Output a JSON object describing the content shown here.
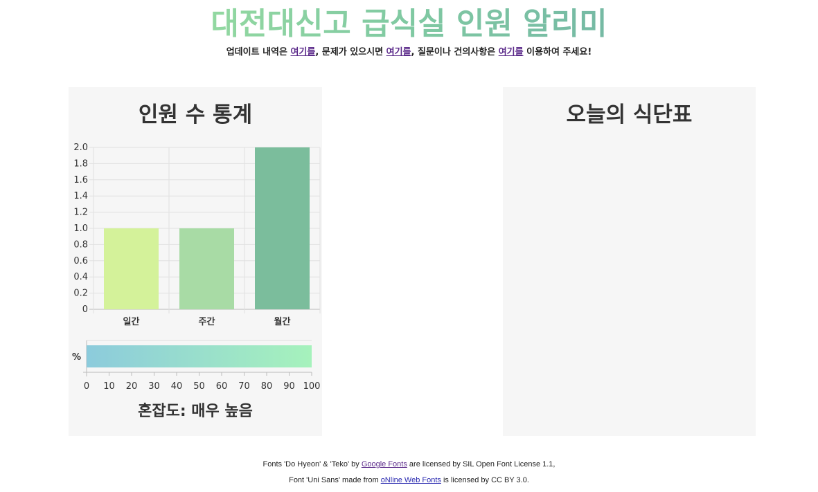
{
  "header": {
    "title": "대전대신고 급식실 인원 알리미",
    "notice": {
      "t1": "업데이트 내역은 ",
      "link1": "여기를",
      "t2": ", 문제가 있으시면 ",
      "link2": "여기를",
      "t3": ", 질문이나 건의사항은 ",
      "link3": "여기를",
      "t4": " 이용하여 주세요!"
    }
  },
  "stats_panel": {
    "title": "인원 수 통계",
    "congestion_label": "혼잡도: 매우 높음"
  },
  "menu_panel": {
    "title": "오늘의 식단표"
  },
  "chart_data": [
    {
      "type": "bar",
      "categories": [
        "일간",
        "주간",
        "월간"
      ],
      "values": [
        1,
        1,
        2
      ],
      "colors": [
        "#d4f29a",
        "#a8dba5",
        "#7bbd9c"
      ],
      "ylim": [
        0,
        2
      ],
      "yticks": [
        "0",
        "0.2",
        "0.4",
        "0.6",
        "0.8",
        "1.0",
        "1.2",
        "1.4",
        "1.6",
        "1.8",
        "2.0"
      ],
      "grid": true
    },
    {
      "type": "bar",
      "orientation": "horizontal",
      "categories": [
        "%"
      ],
      "values": [
        100
      ],
      "xlim": [
        0,
        100
      ],
      "xticks": [
        "0",
        "10",
        "20",
        "30",
        "40",
        "50",
        "60",
        "70",
        "80",
        "90",
        "100"
      ],
      "gradient": [
        "#8ccbdc",
        "#a6f2bc"
      ]
    }
  ],
  "footer": {
    "line1_a": "Fonts 'Do Hyeon' & 'Teko' by ",
    "line1_link": "Google Fonts",
    "line1_b": " are licensed by SIL Open Font License 1.1,",
    "line2_a": "Font 'Uni Sans' made from ",
    "line2_link": "oNline Web Fonts",
    "line2_b": " is licensed by CC BY 3.0."
  }
}
